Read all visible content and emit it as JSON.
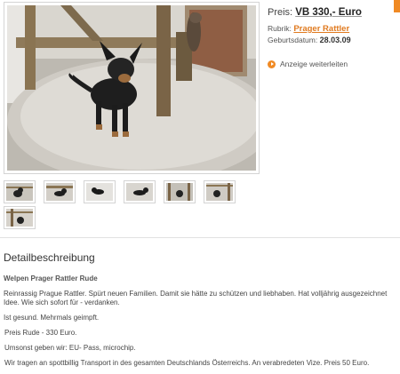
{
  "listing": {
    "price_label": "Preis:",
    "price_value": "VB 330,- Euro",
    "rubrik_label": "Rubrik:",
    "rubrik_value": "Prager Rattler",
    "birth_label": "Geburtsdatum:",
    "birth_value": "28.03.09",
    "forward_label": "Anzeige weiterleiten",
    "accent_color": "#f08a24"
  },
  "photos": {
    "main_alt": "Prager Rattler Welpe",
    "thumbnail_count": 7
  },
  "details": {
    "section_title": "Detailbeschreibung",
    "subtitle": "Welpen Prager Rattler Rude",
    "paragraphs": [
      "Reinrassig Prague Rattler. Spürt neuen Familien. Damit sie hätte zu schützen und liebhaben. Hat volljährig ausgezeichnet Idee. Wie sich sofort für - verdanken.",
      "Ist gesund. Mehrmals geimpft.",
      " Preis Rude - 330 Euro.",
      " Umsonst geben wir: EU- Pass, microchip.",
      " Wir tragen an spottbillig Transport in des gesamten Deutschlands Österreichs. An verabredeten Vize. Preis 50 Euro."
    ]
  }
}
